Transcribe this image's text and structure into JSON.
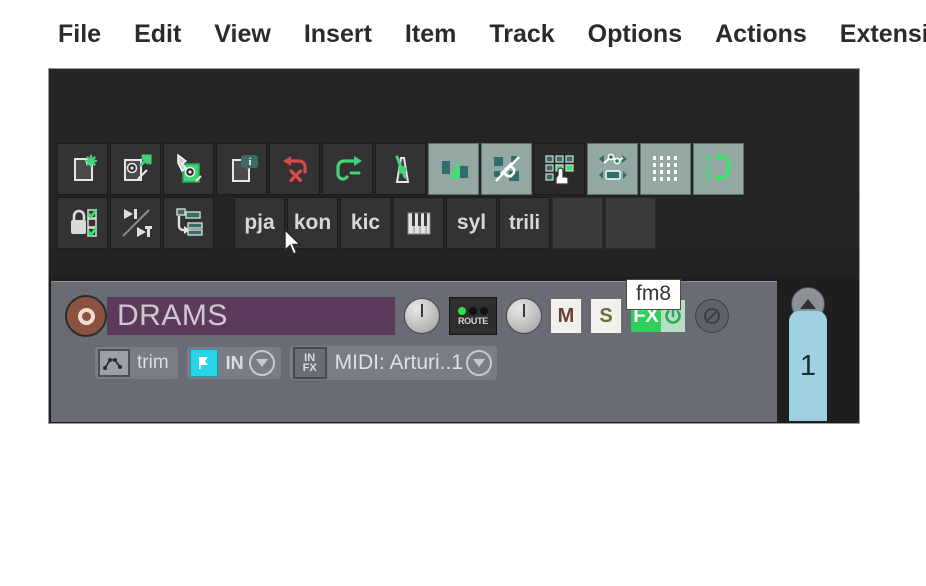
{
  "menu": {
    "items": [
      {
        "label": "File"
      },
      {
        "label": "Edit"
      },
      {
        "label": "View"
      },
      {
        "label": "Insert"
      },
      {
        "label": "Item"
      },
      {
        "label": "Track"
      },
      {
        "label": "Options"
      },
      {
        "label": "Actions"
      },
      {
        "label": "Extensio"
      }
    ]
  },
  "toolbar": {
    "row1": [
      {
        "icon": "new-project-icon",
        "state": "off"
      },
      {
        "icon": "open-project-icon",
        "state": "off"
      },
      {
        "icon": "save-project-icon",
        "state": "off"
      },
      {
        "icon": "project-settings-icon",
        "state": "off"
      },
      {
        "icon": "undo-icon",
        "state": "off"
      },
      {
        "icon": "redo-icon",
        "state": "off"
      },
      {
        "icon": "metronome-icon",
        "state": "off"
      },
      {
        "icon": "crossfade-icon",
        "state": "on"
      },
      {
        "icon": "link-items-icon",
        "state": "on"
      },
      {
        "icon": "grouping-matrix-icon",
        "state": "off"
      },
      {
        "icon": "envelope-points-icon",
        "state": "on"
      },
      {
        "icon": "grid-snap-icon",
        "state": "on"
      },
      {
        "icon": "loop-icon",
        "state": "on"
      }
    ],
    "row2": [
      {
        "icon": "lock-checkboxes-icon",
        "state": "off"
      },
      {
        "icon": "play-to-marker-icon",
        "state": "off"
      },
      {
        "icon": "ripple-edit-icon",
        "state": "off"
      }
    ],
    "text_buttons": [
      {
        "label": "pja"
      },
      {
        "label": "kon"
      },
      {
        "label": "kic"
      },
      {
        "label": "piano-keys-icon",
        "is_icon": true
      },
      {
        "label": "syl"
      },
      {
        "label": "trili"
      },
      {
        "label": ""
      },
      {
        "label": ""
      }
    ]
  },
  "track": {
    "record_arm": "record-arm-icon",
    "name": "DRAMS",
    "volume_knob": "volume-knob",
    "pan_knob": "pan-knob",
    "route_label": "ROUTE",
    "mute_label": "M",
    "solo_label": "S",
    "fx_label": "FX",
    "fx_power": "power-icon",
    "phase_label": "phase-invert-icon",
    "trim_label": "trim",
    "trim_icon": "envelope-icon",
    "monitor_icon": "monitor-input-icon",
    "input_label": "IN",
    "infx_line1": "IN",
    "infx_line2": "FX",
    "midi_label": "MIDI: Arturi..1"
  },
  "tooltip": {
    "text": "fm8"
  },
  "right_strip": {
    "track_number": "1",
    "scroll_up": "scroll-up-icon"
  },
  "colors": {
    "accent_green": "#2fcf5c",
    "track_name_bg": "#5b3a5b",
    "panel_bg": "#696c74",
    "toolbar_bg": "#252525",
    "scrollbar": "#9ed0e2",
    "monitor_cyan": "#2ad4e8"
  }
}
